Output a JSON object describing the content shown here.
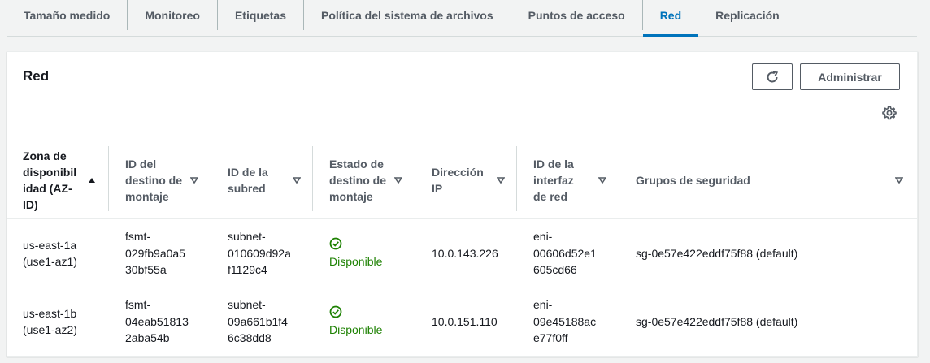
{
  "tabs": [
    {
      "label": "Tamaño medido",
      "active": false
    },
    {
      "label": "Monitoreo",
      "active": false
    },
    {
      "label": "Etiquetas",
      "active": false
    },
    {
      "label": "Política del sistema de archivos",
      "active": false
    },
    {
      "label": "Puntos de acceso",
      "active": false
    },
    {
      "label": "Red",
      "active": true
    },
    {
      "label": "Replicación",
      "active": false
    }
  ],
  "panel": {
    "title": "Red",
    "refresh_icon": "refresh-icon",
    "manage_label": "Administrar",
    "settings_icon": "gear-icon"
  },
  "table": {
    "columns": [
      {
        "lines": [
          "Zona de",
          "disponibil",
          "idad (AZ-",
          "ID)"
        ],
        "sort": "asc"
      },
      {
        "lines": [
          "ID del",
          "destino de",
          "montaje"
        ],
        "sort": "none"
      },
      {
        "lines": [
          "ID de la",
          "subred"
        ],
        "sort": "none"
      },
      {
        "lines": [
          "Estado de",
          "destino de",
          "montaje"
        ],
        "sort": "none"
      },
      {
        "lines": [
          "Dirección",
          "IP"
        ],
        "sort": "none"
      },
      {
        "lines": [
          "ID de la",
          "interfaz",
          "de red"
        ],
        "sort": "none"
      },
      {
        "lines": [
          "Grupos de seguridad"
        ],
        "sort": "none"
      }
    ],
    "rows": [
      {
        "az": [
          "us-east-1a",
          "(use1-az1)"
        ],
        "mount_target": [
          "fsmt-",
          "029fb9a0a5",
          "30bf55a"
        ],
        "subnet": [
          "subnet-",
          "010609d92a",
          "f1129c4"
        ],
        "status": "Disponible",
        "ip": "10.0.143.226",
        "eni": [
          "eni-",
          "00606d52e1",
          "605cd66"
        ],
        "security_groups": "sg-0e57e422eddf75f88 (default)"
      },
      {
        "az": [
          "us-east-1b",
          "(use1-az2)"
        ],
        "mount_target": [
          "fsmt-",
          "04eab51813",
          "2aba54b"
        ],
        "subnet": [
          "subnet-",
          "09a661b1f4",
          "6c38dd8"
        ],
        "status": "Disponible",
        "ip": "10.0.151.110",
        "eni": [
          "eni-",
          "09e45188ac",
          "e77f0ff"
        ],
        "security_groups": "sg-0e57e422eddf75f88 (default)"
      }
    ]
  },
  "colors": {
    "active_tab": "#0073bb",
    "status_ok": "#1d8102",
    "text": "#16191f",
    "muted": "#545b64"
  }
}
